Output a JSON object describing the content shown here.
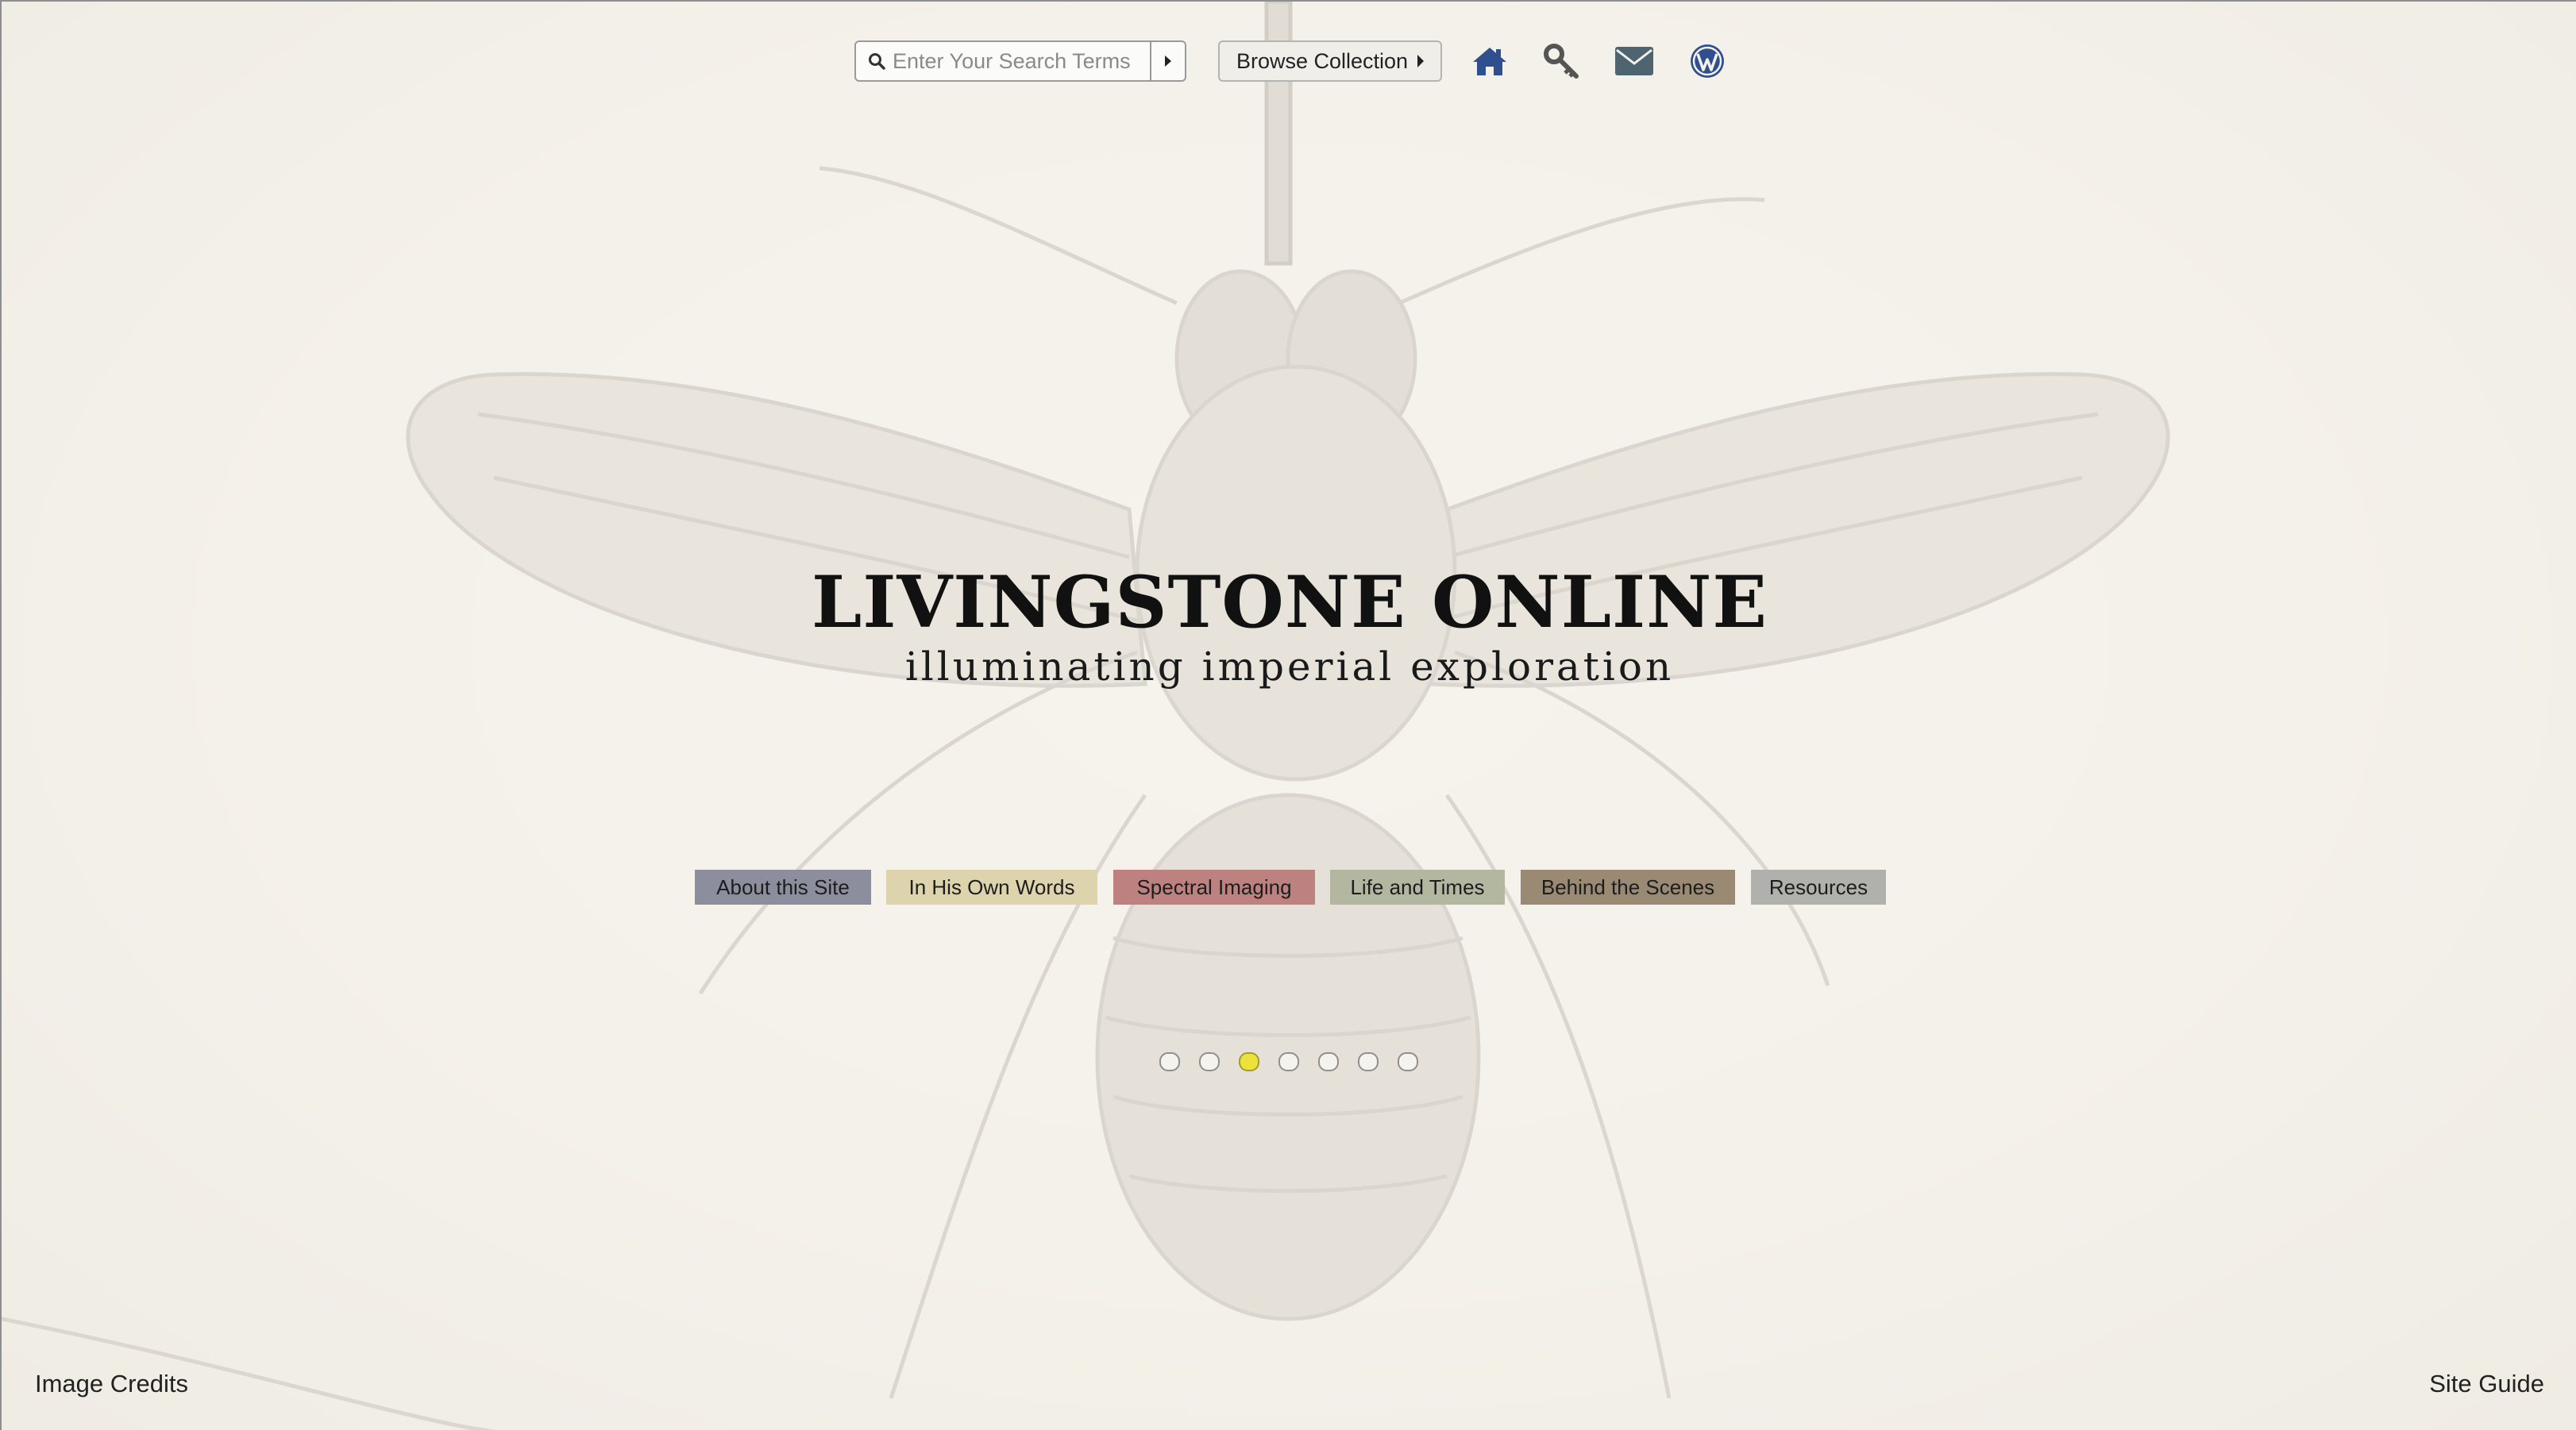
{
  "toolbar": {
    "search_placeholder": "Enter Your Search Terms",
    "browse_label": "Browse Collection",
    "icons": [
      "search-icon",
      "caret-right-icon",
      "home-icon",
      "key-icon",
      "envelope-icon",
      "wordpress-icon"
    ]
  },
  "hero": {
    "title": "LIVINGSTONE ONLINE",
    "subtitle": "illuminating imperial exploration"
  },
  "menu": {
    "items": [
      {
        "label": "About this Site",
        "color": "#8d8e9d"
      },
      {
        "label": "In His Own Words",
        "color": "#ddd3ad"
      },
      {
        "label": "Spectral Imaging",
        "color": "#bd8280"
      },
      {
        "label": "Life and Times",
        "color": "#b3b7a0"
      },
      {
        "label": "Behind the Scenes",
        "color": "#9a8a73"
      },
      {
        "label": "Resources",
        "color": "#b0b0ad"
      }
    ]
  },
  "carousel": {
    "slide_count": 7,
    "active_index": 2,
    "active_color": "#ece23a"
  },
  "footer": {
    "image_credits": "Image Credits",
    "site_guide": "Site Guide"
  },
  "colors": {
    "background": "#f6f3ec",
    "icon_blue": "#2f4f8f",
    "icon_gray": "#555555"
  }
}
